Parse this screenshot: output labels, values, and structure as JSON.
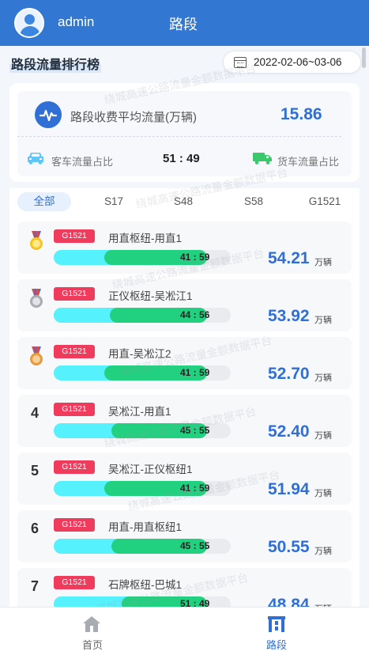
{
  "header": {
    "username": "admin",
    "title": "路段"
  },
  "section": {
    "title": "路段流量排行榜",
    "date_range": "2022-02-06~03-06"
  },
  "summary": {
    "avg_label": "路段收费平均流量(万辆)",
    "avg_value": "15.86",
    "car_label": "客车流量占比",
    "ratio": "51 : 49",
    "truck_label": "货车流量占比"
  },
  "tabs": [
    "全部",
    "S17",
    "S48",
    "S58",
    "G1521"
  ],
  "active_tab": "全部",
  "rows": [
    {
      "rank": "1",
      "medal": "gold",
      "road": "G1521",
      "segment": "用直枢纽-用直1",
      "car_pct": 41,
      "ratio": "41 : 59",
      "flow": "54.21",
      "unit": "万辆"
    },
    {
      "rank": "2",
      "medal": "silver",
      "road": "G1521",
      "segment": "正仪枢纽-吴凇江1",
      "car_pct": 44,
      "ratio": "44 : 56",
      "flow": "53.92",
      "unit": "万辆"
    },
    {
      "rank": "3",
      "medal": "bronze",
      "road": "G1521",
      "segment": "用直-吴凇江2",
      "car_pct": 41,
      "ratio": "41 : 59",
      "flow": "52.70",
      "unit": "万辆"
    },
    {
      "rank": "4",
      "medal": "",
      "road": "G1521",
      "segment": "吴凇江-用直1",
      "car_pct": 45,
      "ratio": "45 : 55",
      "flow": "52.40",
      "unit": "万辆"
    },
    {
      "rank": "5",
      "medal": "",
      "road": "G1521",
      "segment": "吴凇江-正仪枢纽1",
      "car_pct": 41,
      "ratio": "41 : 59",
      "flow": "51.94",
      "unit": "万辆"
    },
    {
      "rank": "6",
      "medal": "",
      "road": "G1521",
      "segment": "用直-用直枢纽1",
      "car_pct": 45,
      "ratio": "45 : 55",
      "flow": "50.55",
      "unit": "万辆"
    },
    {
      "rank": "7",
      "medal": "",
      "road": "G1521",
      "segment": "石牌枢纽-巴城1",
      "car_pct": 51,
      "ratio": "51 : 49",
      "flow": "48.84",
      "unit": "万辆"
    }
  ],
  "watermark": "绕城高速公路流量金额数据平台",
  "nav": {
    "home": "首页",
    "road": "路段"
  },
  "colors": {
    "brand": "#3277d1",
    "accent": "#2f6fd6",
    "badge": "#ef3b5c",
    "car_bar": "#55f1fd",
    "truck_bar": "#22d17f"
  }
}
